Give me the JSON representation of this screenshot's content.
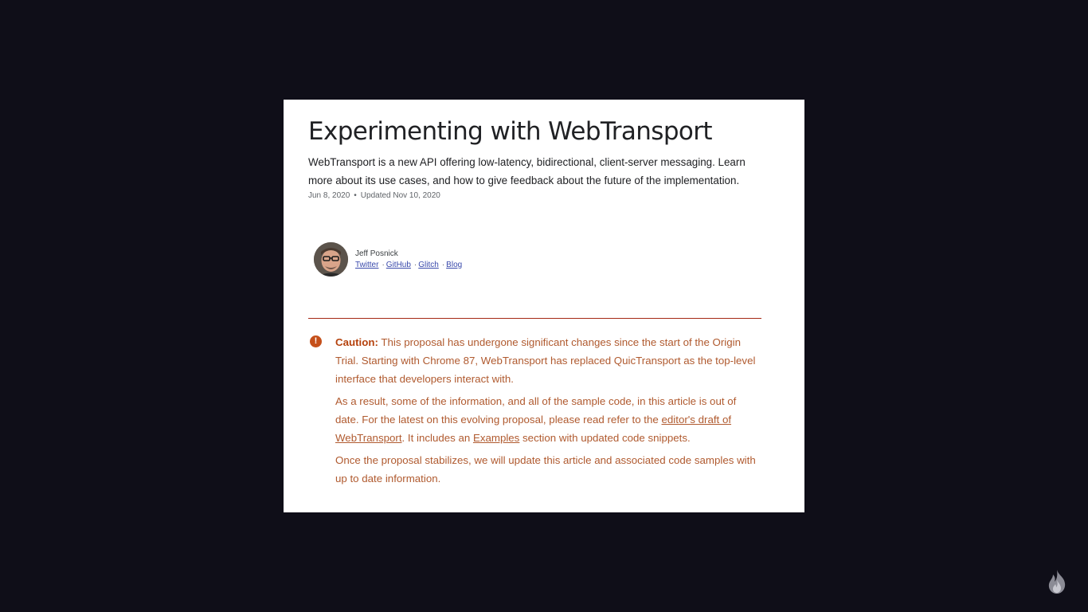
{
  "article": {
    "title": "Experimenting with WebTransport",
    "subtitle": "WebTransport is a new API offering low-latency, bidirectional, client-server messaging. Learn more about its use cases, and how to give feedback about the future of the implementation.",
    "published": "Jun 8, 2020",
    "separator": "•",
    "updated": "Updated Nov 10, 2020"
  },
  "author": {
    "name": "Jeff Posnick",
    "links": [
      "Twitter",
      "GitHub",
      "Glitch",
      "Blog"
    ],
    "link_separator": "·"
  },
  "caution": {
    "label": "Caution:",
    "p1": "This proposal has undergone significant changes since the start of the Origin Trial. Starting with Chrome 87, WebTransport has replaced QuicTransport as the top-level interface that developers interact with.",
    "p2_before": "As a result, some of the information, and all of the sample code, in this article is out of date. For the latest on this evolving proposal, please read refer to the ",
    "p2_link1": "editor's draft of WebTransport",
    "p2_middle": ". It includes an ",
    "p2_link2": "Examples",
    "p2_after": " section with updated code snippets.",
    "p3": "Once the proposal stabilizes, we will update this article and associated code samples with up to date information.",
    "icon": "exclamation-circle-icon",
    "icon_glyph": "!",
    "color": "#b05a2f"
  },
  "branding": {
    "icon": "flame-logo-icon"
  },
  "colors": {
    "background": "#0f0e18",
    "card": "#ffffff",
    "divider": "#a52714"
  }
}
